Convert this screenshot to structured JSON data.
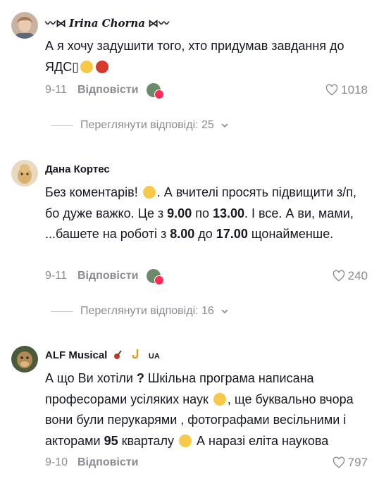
{
  "comments": [
    {
      "author": "Irina Chorna",
      "text": "А я хочу задушити того, хто придумав завдання до ЯДС",
      "date": "9-11",
      "reply_label": "Відповісти",
      "likes": "1018",
      "view_replies": "Переглянути відповіді: 25"
    },
    {
      "author": "Дана Кортес",
      "text_parts": {
        "p1": "Без коментарів! ",
        "p2": ". А вчителі просять підвищити з/п, бо дуже важко. Це з ",
        "t1": "9.00",
        "p3": " по ",
        "t2": "13.00",
        "p4": ". І все. А ви, мами, ...башете на роботі з ",
        "t3": "8.00",
        "p5": " до ",
        "t4": "17.00",
        "p6": " щонайменше."
      },
      "date": "9-11",
      "reply_label": "Відповісти",
      "likes": "240",
      "view_replies": "Переглянути відповіді: 16"
    },
    {
      "author": "ALF Musical",
      "badge": "UA",
      "text_parts": {
        "p1": "А що Ви хотіли ",
        "q": "?",
        "p2": " Шкільна програма написана професорами усіляких наук ",
        "p3": ", ще буквально вчора вони були перукарями , фотографами весільними і акторами ",
        "n": "95",
        "p4": " кварталу ",
        "p5": " А наразі еліта наукова"
      },
      "date": "9-10",
      "reply_label": "Відповісти",
      "likes": "797"
    }
  ],
  "icons": {
    "heart": "heart-outline-icon",
    "chevron": "chevron-down-icon"
  },
  "colors": {
    "text": "#161823",
    "muted": "#8a8b91",
    "accent": "#fe2c55"
  }
}
